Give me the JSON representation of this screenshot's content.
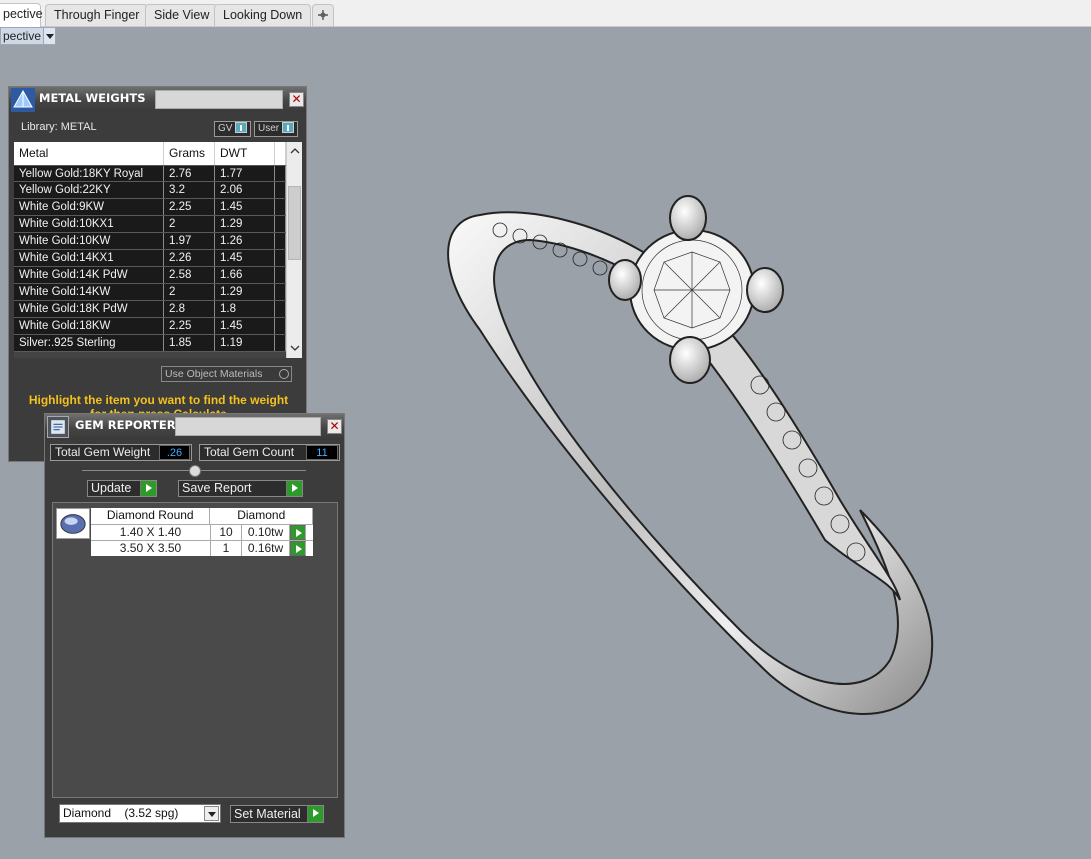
{
  "tabs": [
    {
      "label": "pective",
      "active": true
    },
    {
      "label": "Through Finger",
      "active": false
    },
    {
      "label": "Side View",
      "active": false
    },
    {
      "label": "Looking Down",
      "active": false
    }
  ],
  "add_tab_icon": "plus-icon",
  "viewport_label": "pective",
  "metal_weights": {
    "title": "METAL WEIGHTS",
    "library_label": "Library: METAL",
    "toggle_gv": "GV",
    "toggle_user": "User",
    "columns": [
      "Metal",
      "Grams",
      "DWT"
    ],
    "rows": [
      [
        "Yellow Gold:18KY Royal",
        "2.76",
        "1.77"
      ],
      [
        "Yellow Gold:22KY",
        "3.2",
        "2.06"
      ],
      [
        "White Gold:9KW",
        "2.25",
        "1.45"
      ],
      [
        "White Gold:10KX1",
        "2",
        "1.29"
      ],
      [
        "White Gold:10KW",
        "1.97",
        "1.26"
      ],
      [
        "White Gold:14KX1",
        "2.26",
        "1.45"
      ],
      [
        "White Gold:14K PdW",
        "2.58",
        "1.66"
      ],
      [
        "White Gold:14KW",
        "2",
        "1.29"
      ],
      [
        "White Gold:18K PdW",
        "2.8",
        "1.8"
      ],
      [
        "White Gold:18KW",
        "2.25",
        "1.45"
      ],
      [
        "Silver:.925 Sterling",
        "1.85",
        "1.19"
      ]
    ],
    "use_object_materials": "Use Object Materials",
    "hint_line1": "Highlight the item you want to find the weight",
    "hint_line2": "for then press Calculate"
  },
  "gem_reporter": {
    "title": "GEM REPORTER",
    "total_weight_label": "Total Gem Weight",
    "total_weight_value": ".26",
    "total_count_label": "Total Gem Count",
    "total_count_value": "11",
    "update_label": "Update",
    "save_report_label": "Save Report",
    "table_head_shape": "Diamond Round",
    "table_head_material": "Diamond",
    "gems": [
      {
        "size": "1.40 X 1.40",
        "count": "10",
        "weight": "0.10tw"
      },
      {
        "size": "3.50 X 3.50",
        "count": "1",
        "weight": "0.16tw"
      }
    ],
    "material_select": "Diamond    (3.52 spg)",
    "set_material_label": "Set Material"
  },
  "colors": {
    "viewport_bg": "#9ba1a8",
    "panel_bg": "#3c3c3c",
    "hint_yellow": "#f4c21c",
    "go_green": "#2f9a2c",
    "value_blue": "#3db0ff"
  }
}
